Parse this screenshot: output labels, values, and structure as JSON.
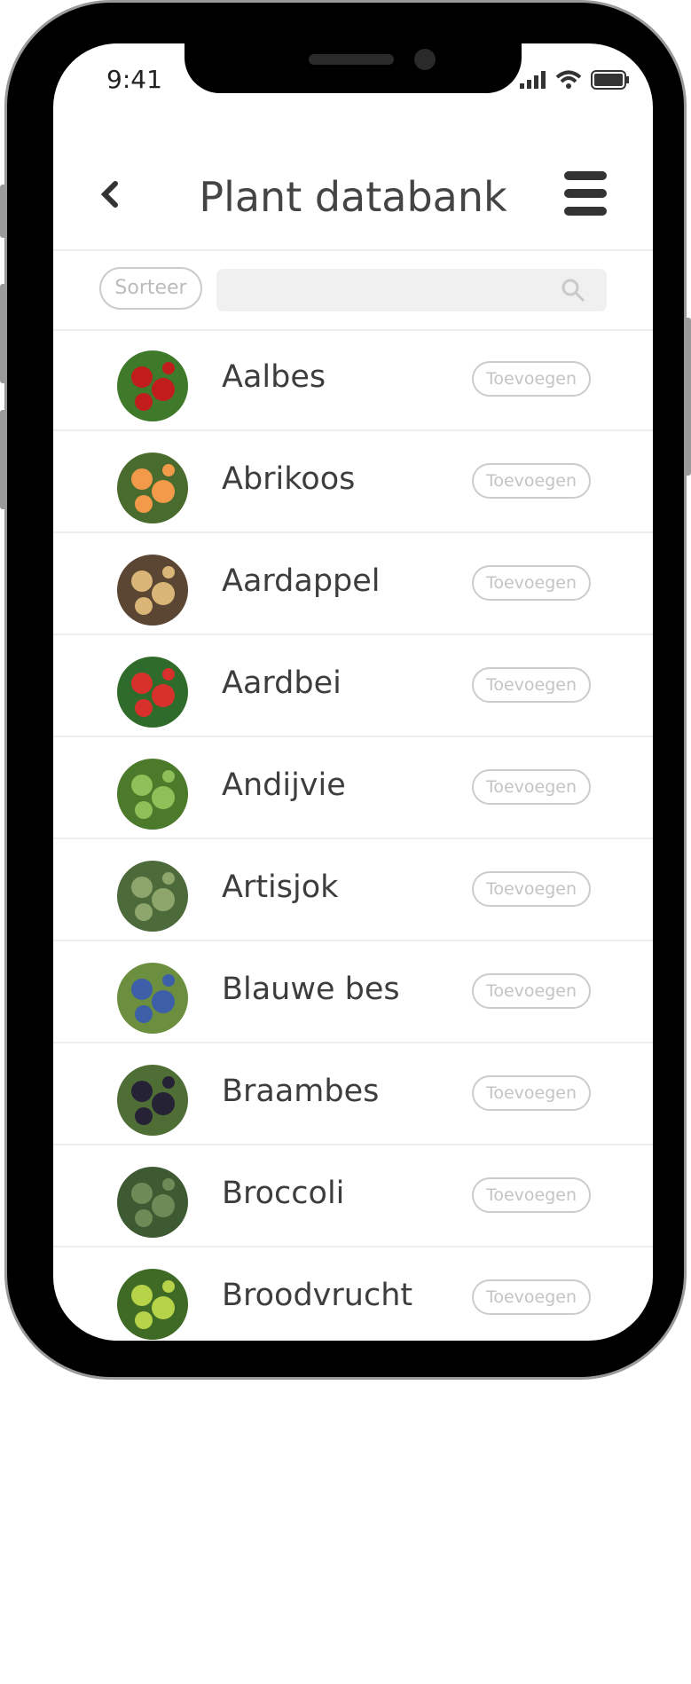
{
  "status_bar": {
    "time": "9:41"
  },
  "header": {
    "title": "Plant databank"
  },
  "search": {
    "sort_label": "Sorteer",
    "placeholder": ""
  },
  "plants": [
    {
      "name": "Aalbes",
      "add_label": "Toevoegen",
      "colors": [
        "#c21d1d",
        "#3f7a2a"
      ]
    },
    {
      "name": "Abrikoos",
      "add_label": "Toevoegen",
      "colors": [
        "#f39a4a",
        "#4a6b2e"
      ]
    },
    {
      "name": "Aardappel",
      "add_label": "Toevoegen",
      "colors": [
        "#d9b577",
        "#5a4632"
      ]
    },
    {
      "name": "Aardbei",
      "add_label": "Toevoegen",
      "colors": [
        "#d8312c",
        "#2f6b2a"
      ]
    },
    {
      "name": "Andijvie",
      "add_label": "Toevoegen",
      "colors": [
        "#8fbf58",
        "#4b7a2b"
      ]
    },
    {
      "name": "Artisjok",
      "add_label": "Toevoegen",
      "colors": [
        "#8ea66b",
        "#4d6b3a"
      ]
    },
    {
      "name": "Blauwe bes",
      "add_label": "Toevoegen",
      "colors": [
        "#3d5fa8",
        "#6b8f3e"
      ]
    },
    {
      "name": "Braambes",
      "add_label": "Toevoegen",
      "colors": [
        "#262236",
        "#4f6e35"
      ]
    },
    {
      "name": "Broccoli",
      "add_label": "Toevoegen",
      "colors": [
        "#6e8a57",
        "#3e5a32"
      ]
    },
    {
      "name": "Broodvrucht",
      "add_label": "Toevoegen",
      "colors": [
        "#b7d34a",
        "#3e6a25"
      ]
    }
  ]
}
